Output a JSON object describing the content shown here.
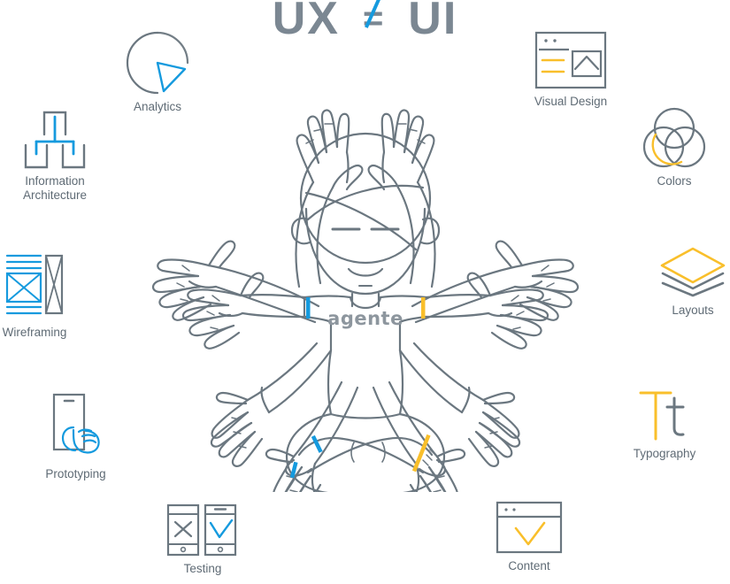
{
  "title": {
    "left": "UX",
    "operator": "≠",
    "right": "UI"
  },
  "colors": {
    "line_gray": "#6b7780",
    "text_gray": "#5f6b75",
    "title_gray": "#7b8792",
    "accent_blue": "#159ade",
    "accent_yellow": "#f9bf2b",
    "shirt_text_gray": "#8d969e",
    "eye_gray": "#8d969e",
    "background": "#ffffff"
  },
  "center_figure": {
    "name": "multi-armed-meditating-designer",
    "shirt_label": "agente",
    "left_stripe_color": "#159ade",
    "right_stripe_color": "#f9bf2b"
  },
  "skills": [
    {
      "id": "analytics",
      "label": "Analytics",
      "icon": "pie-chart-icon",
      "accent": "#159ade"
    },
    {
      "id": "ia",
      "label": "Information\nArchitecture",
      "icon": "hierarchy-tree-icon",
      "accent": "#159ade"
    },
    {
      "id": "wireframing",
      "label": "Wireframing",
      "icon": "wireframe-blocks-icon",
      "accent": "#159ade"
    },
    {
      "id": "prototyping",
      "label": "Prototyping",
      "icon": "phone-tap-hand-icon",
      "accent": "#159ade"
    },
    {
      "id": "testing",
      "label": "Testing",
      "icon": "two-phones-x-check-icon",
      "accent": "#159ade"
    },
    {
      "id": "content",
      "label": "Content",
      "icon": "browser-check-icon",
      "accent": "#f9bf2b"
    },
    {
      "id": "typography",
      "label": "Typography",
      "icon": "letter-tt-icon",
      "accent": "#f9bf2b"
    },
    {
      "id": "layouts",
      "label": "Layouts",
      "icon": "stacked-layers-icon",
      "accent": "#f9bf2b"
    },
    {
      "id": "colors",
      "label": "Colors",
      "icon": "venn-circles-icon",
      "accent": "#f9bf2b"
    },
    {
      "id": "visualdesign",
      "label": "Visual Design",
      "icon": "browser-image-text-icon",
      "accent": "#f9bf2b"
    }
  ]
}
